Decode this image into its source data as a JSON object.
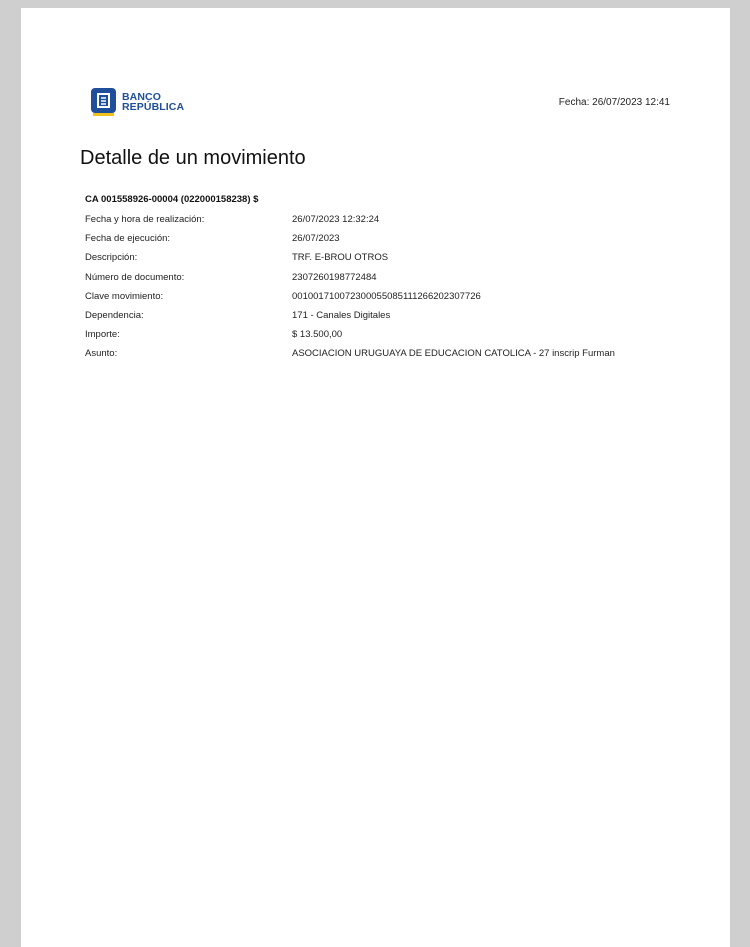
{
  "header": {
    "logo_line1": "BANCO",
    "logo_line2": "REPÚBLICA",
    "fecha": "Fecha: 26/07/2023 12:41"
  },
  "title": "Detalle de un movimiento",
  "account": "CA 001558926-00004 (022000158238) $",
  "details": [
    {
      "label": "Fecha y hora de realización:",
      "value": "26/07/2023 12:32:24"
    },
    {
      "label": "Fecha de ejecución:",
      "value": "26/07/2023"
    },
    {
      "label": "Descripción:",
      "value": "TRF. E-BROU OTROS"
    },
    {
      "label": "Número de documento:",
      "value": "2307260198772484"
    },
    {
      "label": "Clave movimiento:",
      "value": "001001710072300055085111266202307726"
    },
    {
      "label": "Dependencia:",
      "value": "171 - Canales Digitales"
    },
    {
      "label": "Importe:",
      "value": "$ 13.500,00"
    },
    {
      "label": "Asunto:",
      "value": "ASOCIACION URUGUAYA DE EDUCACION CATOLICA - 27 inscrip Furman"
    }
  ],
  "colors": {
    "brand_blue": "#1f4e9a",
    "brand_yellow": "#f2c21b"
  },
  "icons": {
    "logo": "banco-republica-logo-icon"
  }
}
